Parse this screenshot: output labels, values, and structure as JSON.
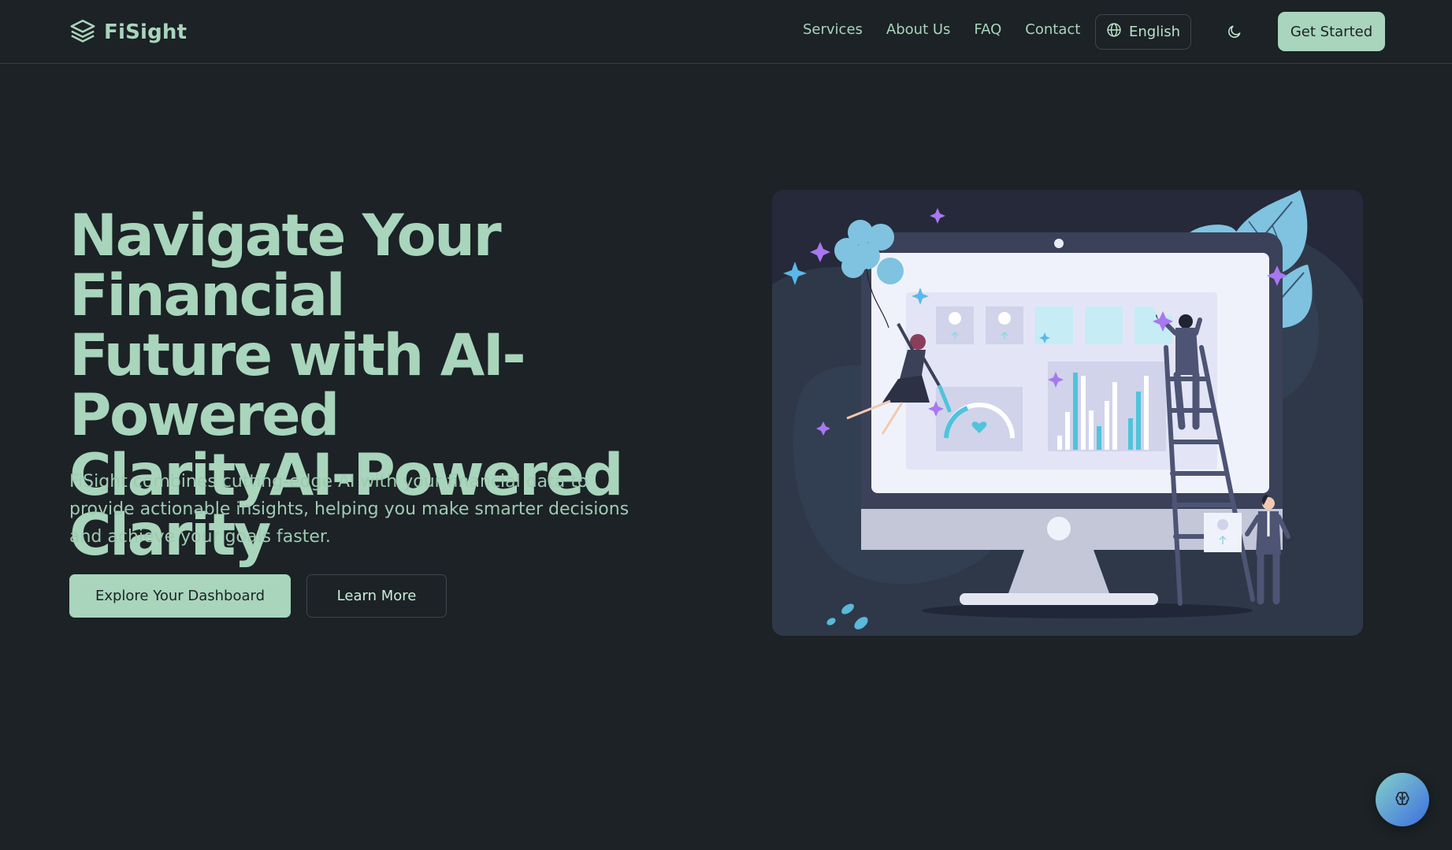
{
  "colors": {
    "background": "#1c2225",
    "accent": "#a8d5bc",
    "border": "#364045",
    "illustration_bg": "#25293a"
  },
  "nav": {
    "brand": "FiSight",
    "brand_icon": "layers-icon",
    "links": [
      "Services",
      "About Us",
      "FAQ",
      "Contact"
    ],
    "language": "English",
    "language_icon": "globe-icon",
    "theme_icon": "moon-icon",
    "cta": "Get Started"
  },
  "hero": {
    "title_lines": [
      "Navigate Your Financial",
      "Future with AI-Powered",
      "ClarityAI-Powered",
      "Clarity"
    ],
    "description": "FiSight combines cutting-edge AI with your financial data to provide actionable insights, helping you make smarter decisions and achieve your goals faster.",
    "primary_button": "Explore Your Dashboard",
    "secondary_button": "Learn More"
  },
  "illustration": {
    "icon": "financial-dashboard-illustration"
  },
  "assistant": {
    "icon": "brain-icon"
  }
}
